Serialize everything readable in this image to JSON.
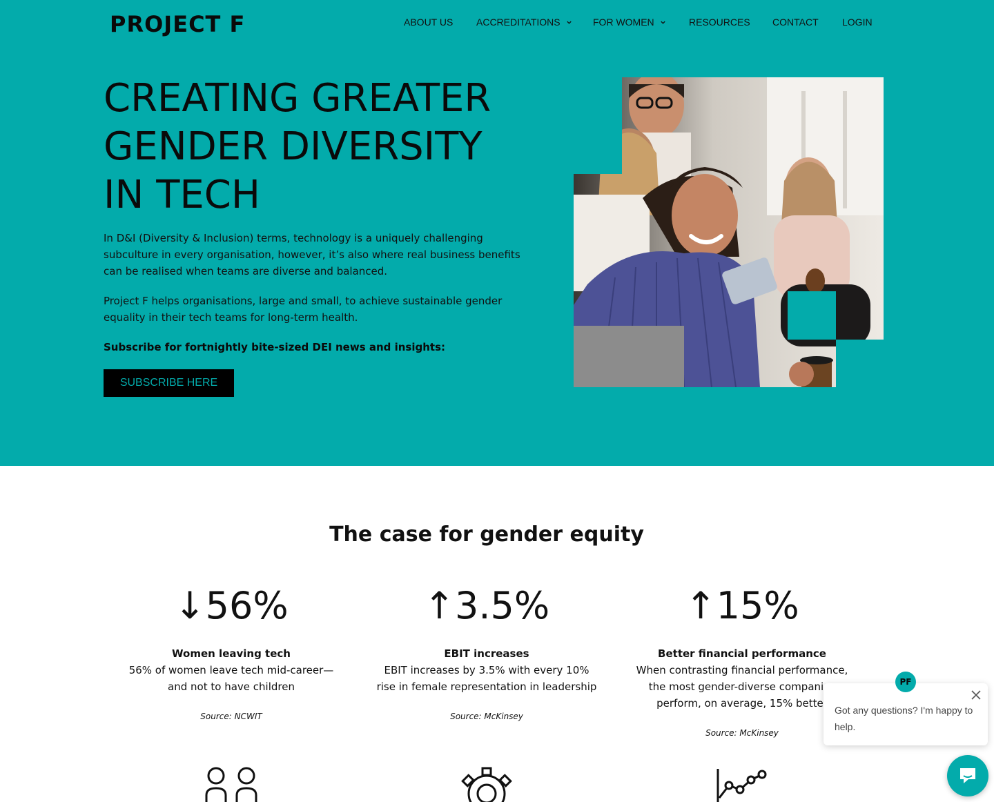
{
  "brand": {
    "logo_text": "PROJECT F",
    "teal": "#03ABAB"
  },
  "nav": {
    "items": [
      {
        "label": "ABOUT US",
        "has_dropdown": false
      },
      {
        "label": "ACCREDITATIONS",
        "has_dropdown": true
      },
      {
        "label": "FOR WOMEN",
        "has_dropdown": true
      },
      {
        "label": "RESOURCES",
        "has_dropdown": false
      },
      {
        "label": "CONTACT",
        "has_dropdown": false
      },
      {
        "label": "LOGIN",
        "has_dropdown": false
      }
    ]
  },
  "hero": {
    "title_lines": [
      "CREATING GREATER",
      "GENDER DIVERSITY",
      "IN TECH"
    ],
    "paragraph1": "In D&I (Diversity & Inclusion) terms, technology is a uniquely challenging subculture in every organisation, however, it’s also where real business benefits can be realised when teams are diverse and balanced.",
    "paragraph2": "Project F helps organisations, large and small, to achieve sustainable gender equality in their tech teams for long-term health.",
    "subscribe_prompt": "Subscribe for fortnightly bite-sized DEI news and insights:",
    "subscribe_button": "SUBSCRIBE HERE"
  },
  "case_section": {
    "title": "The case for gender equity",
    "stats": [
      {
        "arrow": "↓",
        "value": "56%",
        "label": "Women leaving tech",
        "desc": "56% of women leave tech mid-career—and not to have children",
        "source": "Source: NCWIT",
        "icon": "people-icon"
      },
      {
        "arrow": "↑",
        "value": "3.5%",
        "label": "EBIT increases",
        "desc": "EBIT increases by 3.5% with every 10% rise in female representation in leadership",
        "source": "Source: McKinsey",
        "icon": "gear-icon"
      },
      {
        "arrow": "↑",
        "value": "15%",
        "label": "Better financial performance",
        "desc": "When contrasting financial performance, the most gender-diverse companies perform, on average, 15% better",
        "source": "Source: McKinsey",
        "icon": "line-chart-icon"
      }
    ]
  },
  "chat": {
    "avatar_text": "PF",
    "message": "Got any questions? I'm happy to help."
  }
}
